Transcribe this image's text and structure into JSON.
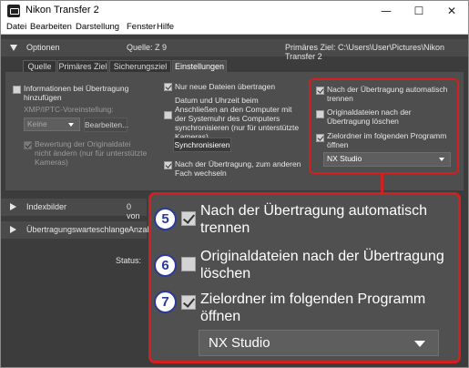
{
  "window": {
    "title": "Nikon Transfer 2",
    "controls": {
      "minimize": "—",
      "maximize": "☐",
      "close": "✕"
    }
  },
  "menu": [
    "Datei",
    "Bearbeiten",
    "Darstellung",
    "Fenster",
    "Hilfe"
  ],
  "options_header": {
    "label": "Optionen",
    "source": "Quelle: Z 9",
    "primary_target": "Primäres Ziel: C:\\Users\\User\\Pictures\\Nikon Transfer 2"
  },
  "tabs": [
    "Quelle",
    "Primäres Ziel",
    "Sicherungsziel",
    "Einstellungen"
  ],
  "active_tab": "Einstellungen",
  "settings": {
    "col1": {
      "add_info_label": "Informationen bei Übertragung hinzufügen",
      "xmp_label": "XMP/IPTC-Voreinstellung:",
      "xmp_value": "Keine",
      "edit_button": "Bearbeiten...",
      "rating_label": "Bewertung der Originaldatei nicht ändern (nur für unterstützte Kameras)"
    },
    "col2": {
      "new_files_label": "Nur neue Dateien übertragen",
      "sync_label": "Datum und Uhrzeit beim Anschließen an den Computer mit der Systemuhr des Computers synchronisieren (nur für unterstützte Kameras)",
      "sync_button": "Synchronisieren",
      "switch_label": "Nach der Übertragung, zum anderen Fach wechseln"
    },
    "col3": {
      "auto_quit_label": "Nach der Übertragung automatisch trennen",
      "delete_label": "Originaldateien nach der Übertragung löschen",
      "open_folder_label": "Zielordner im folgenden Programm öffnen",
      "program_value": "NX Studio"
    }
  },
  "index_header": {
    "label": "Indexbilder",
    "count": "0 von"
  },
  "queue_header": {
    "label": "Übertragungswarteschlange",
    "extra": "Anzah"
  },
  "status_label": "Status:",
  "zoom": {
    "items": [
      {
        "badge": "5",
        "label": "Nach der Übertragung automatisch trennen",
        "checked": true
      },
      {
        "badge": "6",
        "label": "Originaldateien nach der Übertragung löschen",
        "checked": false
      },
      {
        "badge": "7",
        "label": "Zielordner im folgenden Programm öffnen",
        "checked": true
      }
    ],
    "program_value": "NX Studio"
  },
  "colors": {
    "highlight": "#d21f1f",
    "badge": "#2b3a9a",
    "panel": "#4e4e4e"
  }
}
